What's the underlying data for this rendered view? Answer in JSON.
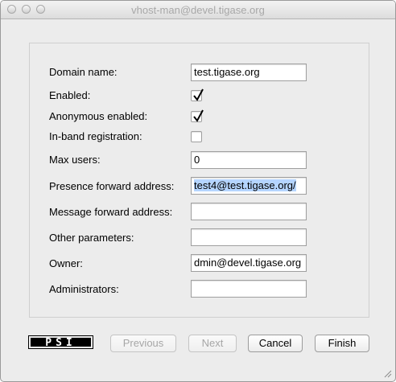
{
  "window": {
    "title": "vhost-man@devel.tigase.org"
  },
  "form": {
    "domain_name": {
      "label": "Domain name:",
      "value": "test.tigase.org"
    },
    "enabled": {
      "label": "Enabled:",
      "checked": true
    },
    "anonymous_enabled": {
      "label": "Anonymous enabled:",
      "checked": true
    },
    "in_band_registration": {
      "label": "In-band registration:",
      "checked": false
    },
    "max_users": {
      "label": "Max users:",
      "value": "0"
    },
    "presence_forward_address": {
      "label": "Presence forward address:",
      "value": "test4@test.tigase.org/"
    },
    "message_forward_address": {
      "label": "Message forward address:",
      "value": ""
    },
    "other_parameters": {
      "label": "Other parameters:",
      "value": ""
    },
    "owner": {
      "label": "Owner:",
      "value": "dmin@devel.tigase.org"
    },
    "administrators": {
      "label": "Administrators:",
      "value": ""
    }
  },
  "logo": {
    "text": "PSI"
  },
  "buttons": {
    "previous": "Previous",
    "next": "Next",
    "cancel": "Cancel",
    "finish": "Finish"
  },
  "icons": {
    "close": "close-icon",
    "minimize": "minimize-icon",
    "zoom": "zoom-icon",
    "checkmark": "checkmark-icon",
    "resize": "resize-grip-icon"
  }
}
